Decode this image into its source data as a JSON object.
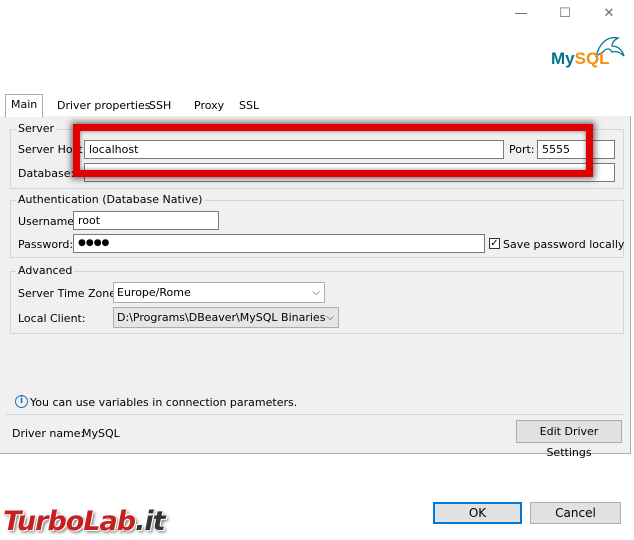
{
  "window": {
    "controls": [
      "—",
      "☐",
      "✕"
    ]
  },
  "logo": {
    "my": "My",
    "sql": "SQL"
  },
  "tabs": [
    "Main",
    "Driver properties",
    "SSH",
    "Proxy",
    "SSL"
  ],
  "server": {
    "group_label": "Server",
    "host_label": "Server Host:",
    "host_value": "localhost",
    "port_label": "Port:",
    "port_value": "5555",
    "database_label": "Database:",
    "database_value": ""
  },
  "auth": {
    "group_label": "Authentication (Database Native)",
    "username_label": "Username:",
    "username_value": "root",
    "password_label": "Password:",
    "password_value": "●●●●",
    "save_password_label": "Save password locally",
    "save_password_checked": "✓"
  },
  "advanced": {
    "group_label": "Advanced",
    "timezone_label": "Server Time Zone:",
    "timezone_value": "Europe/Rome",
    "client_label": "Local Client:",
    "client_value": "D:\\Programs\\DBeaver\\MySQL Binaries"
  },
  "info": {
    "icon": "i",
    "text": "You can use variables in connection parameters."
  },
  "driver": {
    "label": "Driver name:",
    "value": "MySQL",
    "edit_button": "Edit Driver Settings"
  },
  "footer": {
    "ok": "OK",
    "cancel": "Cancel"
  },
  "watermark": {
    "part1": "TurboLab",
    "part2": ".it"
  },
  "colors": {
    "highlight": "#e10000",
    "accent": "#0078d7",
    "logo_blue": "#00758f",
    "logo_orange": "#f29111"
  }
}
